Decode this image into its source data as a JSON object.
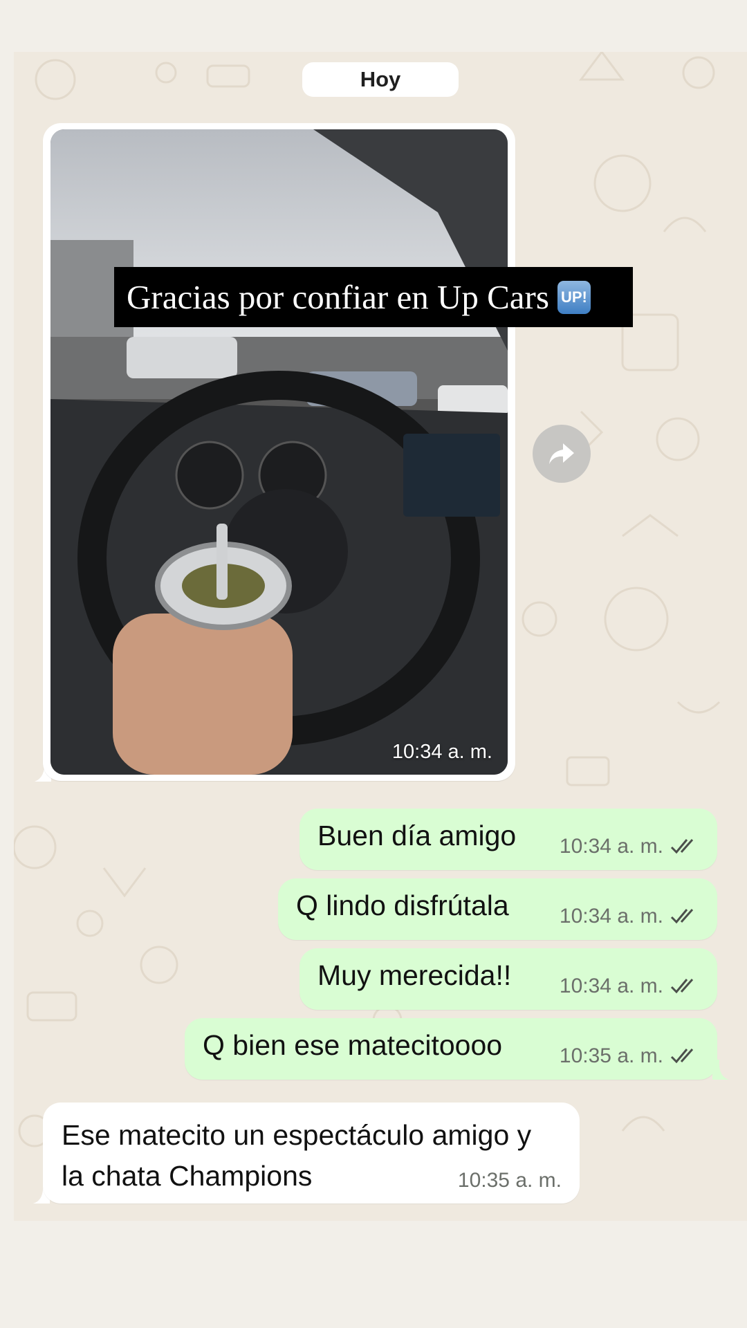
{
  "chat": {
    "date_chip": "Hoy",
    "image_message": {
      "time": "10:34 a. m.",
      "caption_overlay": "Gracias por confiar en Up Cars",
      "emoji_badge": "UP!"
    },
    "forward_icon": "forward-arrow-icon",
    "outgoing": [
      {
        "text": "Buen día amigo",
        "time": "10:34 a. m.",
        "status_icon": "double-check-icon"
      },
      {
        "text": "Q lindo disfrútala",
        "time": "10:34 a. m.",
        "status_icon": "double-check-icon"
      },
      {
        "text": "Muy merecida!!",
        "time": "10:34 a. m.",
        "status_icon": "double-check-icon"
      },
      {
        "text": "Q bien ese matecitoooo",
        "time": "10:35 a. m.",
        "status_icon": "double-check-icon"
      }
    ],
    "incoming": [
      {
        "text": "Ese matecito un espectáculo amigo y la chata Champions",
        "time": "10:35 a. m."
      }
    ]
  },
  "colors": {
    "outgoing_bubble": "#d9fdd3",
    "incoming_bubble": "#ffffff",
    "wallpaper": "#efe9df"
  }
}
